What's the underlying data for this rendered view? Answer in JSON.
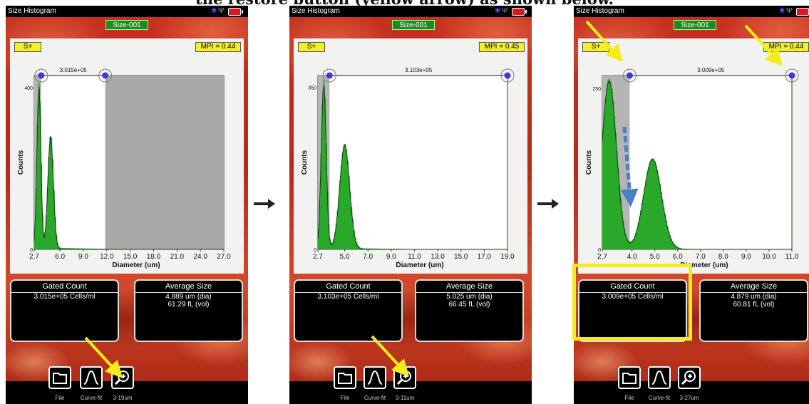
{
  "caption": "the restore button (yellow arrow) as shown below.",
  "colors": {
    "accent_yellow": "#f4ec1a",
    "histogram_green": "#2aa82a",
    "gate_grey": "#a9a9a9",
    "handle_blue": "#3a3ad8"
  },
  "screens": [
    {
      "title": "Size Histogram",
      "sample": "Size-001",
      "gate_button": "S+",
      "mpi": "MPI = 0.44",
      "gate_value": "3.015e+05",
      "ylabel": "Counts",
      "xlabel": "Diameter (um)",
      "gated_count_title": "Gated Count",
      "gated_count": "3.015e+05 Cells/ml",
      "avg_size_title": "Average Size",
      "avg_dia": "4.889 um (dia)",
      "avg_vol": "61.29 fL (vol)",
      "toolbar": [
        {
          "label": "File",
          "icon": "folder-icon"
        },
        {
          "label": "Curve-fit",
          "icon": "bell-curve-icon"
        },
        {
          "label": "3-19um",
          "icon": "zoom-restore-icon"
        }
      ]
    },
    {
      "title": "Size Histogram",
      "sample": "Size-001",
      "gate_button": "S+",
      "mpi": "MPI = 0.45",
      "gate_value": "3.103e+05",
      "ylabel": "Counts",
      "xlabel": "Diameter (um)",
      "gated_count_title": "Gated Count",
      "gated_count": "3.103e+05 Cells/ml",
      "avg_size_title": "Average Size",
      "avg_dia": "5.025 um (dia)",
      "avg_vol": "66.45 fL (vol)",
      "toolbar": [
        {
          "label": "File",
          "icon": "folder-icon"
        },
        {
          "label": "Curve-fit",
          "icon": "bell-curve-icon"
        },
        {
          "label": "3-11um",
          "icon": "zoom-restore-icon"
        }
      ]
    },
    {
      "title": "Size Histogram",
      "sample": "Size-001",
      "gate_button": "S+",
      "mpi": "MPI = 0.44",
      "gate_value": "3.009e+05",
      "ylabel": "Counts",
      "xlabel": "Diameter (um)",
      "gated_count_title": "Gated Count",
      "gated_count": "3.009e+05 Cells/ml",
      "avg_size_title": "Average Size",
      "avg_dia": "4.879 um (dia)",
      "avg_vol": "60.81 fL (vol)",
      "toolbar": [
        {
          "label": "File",
          "icon": "folder-icon"
        },
        {
          "label": "Curve-fit",
          "icon": "bell-curve-icon"
        },
        {
          "label": "3-27um",
          "icon": "zoom-restore-icon"
        }
      ]
    }
  ],
  "chart_data": [
    {
      "type": "bar",
      "ylabel": "Counts",
      "xlabel": "Diameter (um)",
      "xlim": [
        2.7,
        27.0
      ],
      "ylim": [
        0,
        430
      ],
      "xticks": [
        "2.7",
        "6.0",
        "9.0",
        "12.0",
        "15.0",
        "18.0",
        "21.0",
        "24.0",
        "27.0"
      ],
      "xtick_values": [
        2.7,
        6.0,
        9.0,
        12.0,
        15.0,
        18.0,
        21.0,
        24.0,
        27.0
      ],
      "yticks": [
        "0",
        "400"
      ],
      "ytick_values": [
        0,
        400
      ],
      "gate": [
        3.6,
        11.8
      ],
      "gate_label": "3.015e+05",
      "peaks": [
        {
          "center": 3.3,
          "height": 410,
          "width": 0.35
        },
        {
          "center": 4.8,
          "height": 280,
          "width": 0.5
        }
      ]
    },
    {
      "type": "bar",
      "ylabel": "Counts",
      "xlabel": "Diameter (um)",
      "xlim": [
        2.7,
        19.0
      ],
      "ylim": [
        0,
        375
      ],
      "xticks": [
        "2.7",
        "5.0",
        "7.0",
        "9.0",
        "11.0",
        "13.0",
        "15.0",
        "17.0",
        "19.0"
      ],
      "xtick_values": [
        2.7,
        5.0,
        7.0,
        9.0,
        11.0,
        13.0,
        15.0,
        17.0,
        19.0
      ],
      "yticks": [
        "0",
        "350"
      ],
      "ytick_values": [
        0,
        350
      ],
      "gate": [
        3.7,
        19.0
      ],
      "gate_label": "3.103e+05",
      "peaks": [
        {
          "center": 3.2,
          "height": 360,
          "width": 0.3
        },
        {
          "center": 5.0,
          "height": 225,
          "width": 0.6
        }
      ]
    },
    {
      "type": "bar",
      "ylabel": "Counts",
      "xlabel": "Diameter (um)",
      "xlim": [
        2.7,
        11.0
      ],
      "ylim": [
        0,
        270
      ],
      "xticks": [
        "2.7",
        "4.0",
        "5.0",
        "6.0",
        "7.0",
        "8.0",
        "9.0",
        "10.0",
        "11.0"
      ],
      "xtick_values": [
        2.7,
        4.0,
        5.0,
        6.0,
        7.0,
        8.0,
        9.0,
        10.0,
        11.0
      ],
      "yticks": [
        "0",
        "250"
      ],
      "ytick_values": [
        0,
        250
      ],
      "gate": [
        3.9,
        11.0
      ],
      "gate_label": "3.009e+05",
      "peaks": [
        {
          "center": 3.0,
          "height": 262,
          "width": 0.45
        },
        {
          "center": 4.9,
          "height": 140,
          "width": 0.55
        }
      ]
    }
  ]
}
